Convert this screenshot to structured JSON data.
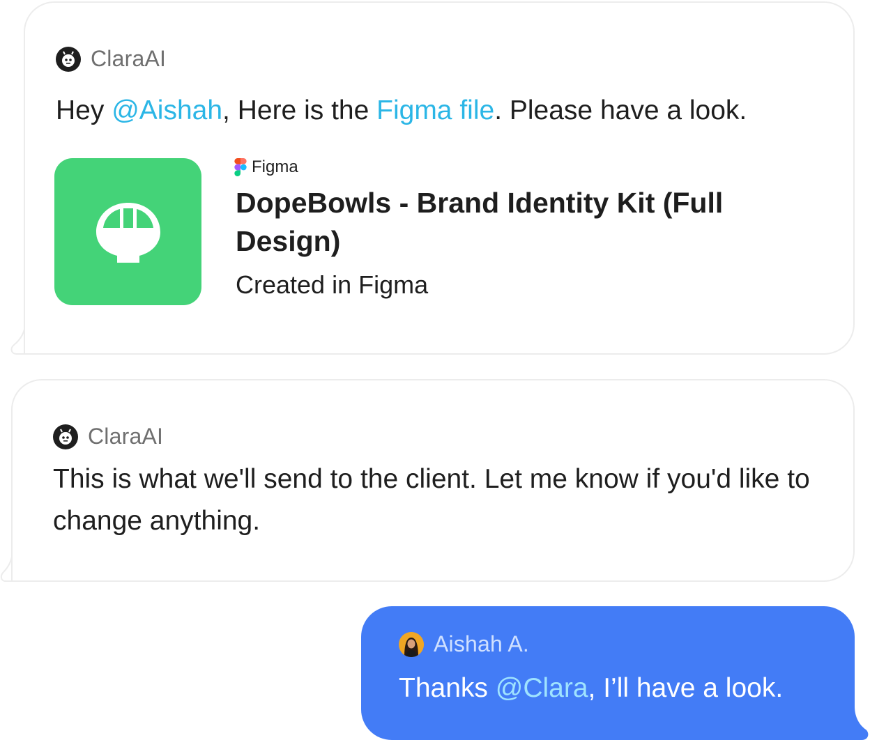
{
  "messages": [
    {
      "sender": "ClaraAI",
      "text_parts": {
        "p1": "Hey ",
        "mention": "@Aishah",
        "p2": ", Here is the ",
        "link": "Figma file",
        "p3": ". Please have a look."
      },
      "attachment": {
        "source": "Figma",
        "title": "DopeBowls - Brand Identity Kit (Full Design)",
        "subtitle": "Created in Figma",
        "thumb_color": "#44d378",
        "thumb_icon": "bowl-logo-icon"
      }
    },
    {
      "sender": "ClaraAI",
      "text": "This is what we'll send to the client. Let me know if you'd like to change anything."
    },
    {
      "sender": "Aishah A.",
      "text_parts": {
        "p1": "Thanks ",
        "mention": "@Clara",
        "p2": ", I’ll have a look."
      },
      "bubble_color": "#437cf6"
    }
  ],
  "colors": {
    "mention": "#2bb6e6",
    "bubble_border": "#ececec",
    "outgoing_bubble": "#437cf6"
  }
}
